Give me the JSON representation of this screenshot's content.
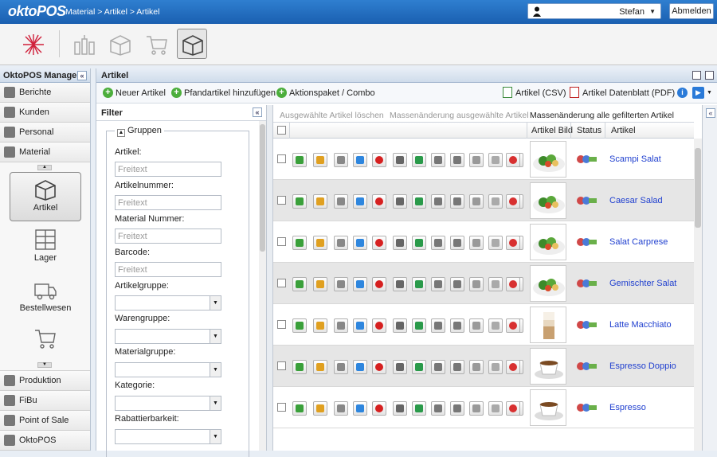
{
  "app": {
    "logo": "oktoPOS",
    "breadcrumb": "Material > Artikel > Artikel"
  },
  "user": {
    "name": "Stefan",
    "logout_label": "Abmelden"
  },
  "toolbar": {
    "icons": [
      "compass-icon",
      "bottles-icon",
      "box-icon",
      "cart-icon",
      "box-open-icon"
    ]
  },
  "nav": {
    "title": "OktoPOS Manager",
    "items_top": [
      {
        "label": "Berichte",
        "icon": "chart-icon"
      },
      {
        "label": "Kunden",
        "icon": "customers-icon"
      },
      {
        "label": "Personal",
        "icon": "person-icon"
      },
      {
        "label": "Material",
        "icon": "box-icon"
      }
    ],
    "sub": [
      {
        "label": "Artikel",
        "icon": "box-icon",
        "active": true
      },
      {
        "label": "Lager",
        "icon": "shelf-icon"
      },
      {
        "label": "Bestellwesen",
        "icon": "truck-icon"
      },
      {
        "label": "",
        "icon": "cart-icon"
      }
    ],
    "items_bottom": [
      {
        "label": "Produktion",
        "icon": "factory-icon"
      },
      {
        "label": "FiBu",
        "icon": "ledger-icon"
      },
      {
        "label": "Point of Sale",
        "icon": "pos-icon"
      },
      {
        "label": "OktoPOS",
        "icon": "octo-icon"
      }
    ]
  },
  "main": {
    "title": "Artikel",
    "actions": {
      "new_article": "Neuer Artikel",
      "add_deposit": "Pfandartikel hinzufügen",
      "action_pack": "Aktionspaket / Combo",
      "export_csv": "Artikel (CSV)",
      "datasheet_pdf": "Artikel Datenblatt (PDF)"
    }
  },
  "filter": {
    "title": "Filter",
    "group_legend": "Gruppen",
    "fields": [
      {
        "label": "Artikel:",
        "type": "text",
        "placeholder": "Freitext"
      },
      {
        "label": "Artikelnummer:",
        "type": "text",
        "placeholder": "Freitext"
      },
      {
        "label": "Material Nummer:",
        "type": "text",
        "placeholder": "Freitext"
      },
      {
        "label": "Barcode:",
        "type": "text",
        "placeholder": "Freitext"
      },
      {
        "label": "Artikelgruppe:",
        "type": "select"
      },
      {
        "label": "Warengruppe:",
        "type": "select"
      },
      {
        "label": "Materialgruppe:",
        "type": "select"
      },
      {
        "label": "Kategorie:",
        "type": "select"
      },
      {
        "label": "Rabattierbarkeit:",
        "type": "select"
      }
    ]
  },
  "grid": {
    "bulk": {
      "delete_selected": "Ausgewählte Artikel löschen",
      "bulk_edit_selected": "Massenänderung ausgewählte Artikel",
      "bulk_edit_filtered": "Massenänderung alle gefilterten Artikel"
    },
    "columns": {
      "image": "Artikel Bild",
      "status": "Status",
      "article": "Artikel"
    },
    "row_action_icons": [
      "arrow-right-icon",
      "pencil-icon",
      "copy-icon",
      "calculator-icon",
      "apple-icon",
      "barcode-icon",
      "dollar-icon",
      "table-icon",
      "truck-icon",
      "bell-icon",
      "document-icon",
      "green-light-icon",
      "stop-icon"
    ],
    "rows": [
      {
        "name": "Scampi Salat",
        "image": "salad"
      },
      {
        "name": "Caesar Salad",
        "image": "salad"
      },
      {
        "name": "Salat Carprese",
        "image": "salad"
      },
      {
        "name": "Gemischter Salat",
        "image": "salad"
      },
      {
        "name": "Latte Macchiato",
        "image": "glass"
      },
      {
        "name": "Espresso Doppio",
        "image": "cup"
      },
      {
        "name": "Espresso",
        "image": "cup"
      }
    ]
  },
  "colors": {
    "header": "#1a5fb0",
    "link": "#1f3fcf",
    "green": "#4cae3c"
  }
}
